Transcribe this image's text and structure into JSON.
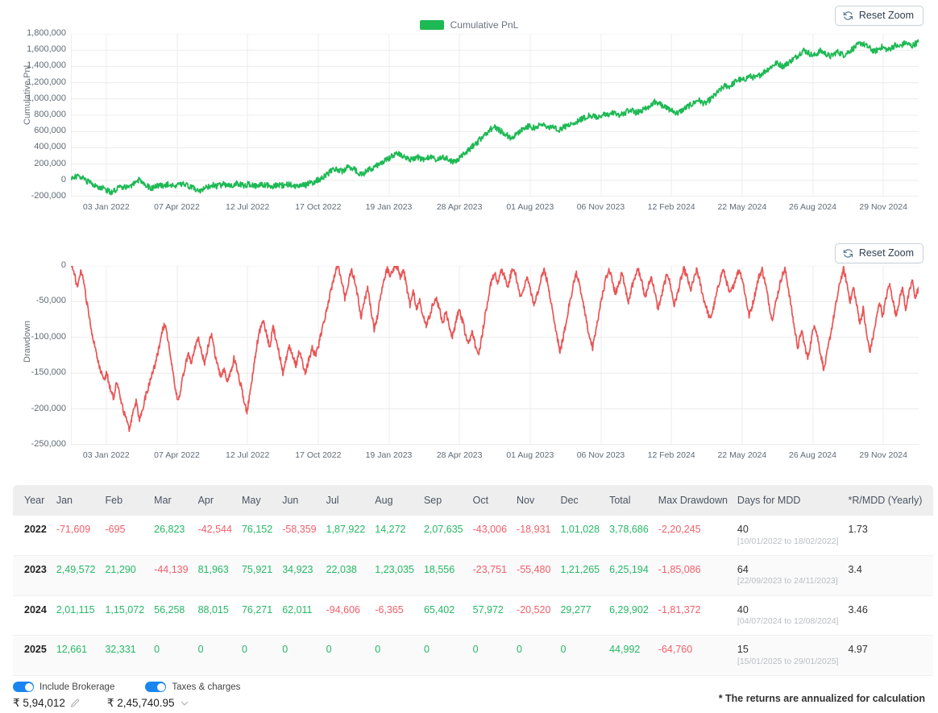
{
  "charts": {
    "pnl": {
      "reset_zoom_label": "Reset Zoom",
      "legend_label": "Cumulative PnL",
      "y_axis_title": "Cumulative PnL",
      "line_color": "#1db954"
    },
    "drawdown": {
      "reset_zoom_label": "Reset Zoom",
      "y_axis_title": "Drawdown",
      "line_color": "#ea5455"
    }
  },
  "chart_data": [
    {
      "type": "line",
      "name": "cumulative-pnl",
      "title": "",
      "xlabel": "",
      "ylabel": "Cumulative PnL",
      "legend": [
        "Cumulative PnL"
      ],
      "legend_position": "top-center",
      "grid": true,
      "ylim": [
        -200000,
        1800000
      ],
      "yticks": [
        1800000,
        1600000,
        1400000,
        1200000,
        1000000,
        800000,
        600000,
        400000,
        200000,
        0,
        -200000
      ],
      "ytick_labels": [
        "1,800,000",
        "1,600,000",
        "1,400,000",
        "1,200,000",
        "1,000,000",
        "800,000",
        "600,000",
        "400,000",
        "200,000",
        "0",
        "-200,000"
      ],
      "xtick_labels": [
        "03 Jan 2022",
        "07 Apr 2022",
        "12 Jul 2022",
        "17 Oct 2022",
        "19 Jan 2023",
        "28 Apr 2023",
        "01 Aug 2023",
        "06 Nov 2023",
        "12 Feb 2024",
        "22 May 2024",
        "26 Aug 2024",
        "29 Nov 2024"
      ],
      "series": [
        {
          "name": "Cumulative PnL",
          "color": "#1db954",
          "values": [
            0,
            30000,
            70000,
            40000,
            10000,
            -20000,
            -45000,
            -60000,
            -75000,
            -90000,
            -110000,
            -130000,
            -145000,
            -125000,
            -100000,
            -85000,
            -70000,
            -90000,
            -60000,
            -30000,
            5000,
            -20000,
            -55000,
            -80000,
            -95000,
            -75000,
            -60000,
            -70000,
            -55000,
            -45000,
            -60000,
            -75000,
            -58000,
            -48000,
            -62000,
            -80000,
            -95000,
            -115000,
            -135000,
            -110000,
            -85000,
            -70000,
            -60000,
            -75000,
            -62000,
            -48000,
            -58000,
            -70000,
            -55000,
            -42000,
            -55000,
            -68000,
            -52000,
            -45000,
            -60000,
            -72000,
            -58000,
            -50000,
            -65000,
            -78000,
            -66000,
            -54000,
            -68000,
            -58000,
            -48000,
            -60000,
            -72000,
            -60000,
            -50000,
            -62000,
            -45000,
            -30000,
            -15000,
            5000,
            25000,
            60000,
            90000,
            120000,
            145000,
            125000,
            105000,
            140000,
            165000,
            150000,
            120000,
            90000,
            75000,
            105000,
            130000,
            155000,
            175000,
            200000,
            225000,
            250000,
            280000,
            310000,
            340000,
            310000,
            285000,
            265000,
            250000,
            270000,
            290000,
            270000,
            255000,
            270000,
            290000,
            265000,
            250000,
            265000,
            280000,
            260000,
            240000,
            225000,
            250000,
            285000,
            320000,
            360000,
            400000,
            440000,
            475000,
            520000,
            560000,
            600000,
            635000,
            655000,
            630000,
            600000,
            570000,
            540000,
            515000,
            550000,
            590000,
            620000,
            650000,
            665000,
            640000,
            655000,
            670000,
            690000,
            665000,
            645000,
            660000,
            640000,
            625000,
            645000,
            665000,
            680000,
            700000,
            720000,
            745000,
            760000,
            780000,
            800000,
            785000,
            770000,
            790000,
            810000,
            795000,
            810000,
            830000,
            815000,
            800000,
            820000,
            845000,
            860000,
            845000,
            830000,
            855000,
            875000,
            895000,
            930000,
            965000,
            950000,
            930000,
            905000,
            880000,
            860000,
            840000,
            825000,
            855000,
            880000,
            910000,
            930000,
            960000,
            990000,
            960000,
            940000,
            975000,
            1010000,
            1050000,
            1090000,
            1130000,
            1165000,
            1150000,
            1180000,
            1215000,
            1240000,
            1225000,
            1250000,
            1280000,
            1270000,
            1255000,
            1290000,
            1320000,
            1350000,
            1380000,
            1410000,
            1440000,
            1425000,
            1400000,
            1430000,
            1460000,
            1490000,
            1520000,
            1560000,
            1600000,
            1580000,
            1555000,
            1530000,
            1560000,
            1590000,
            1570000,
            1545000,
            1520000,
            1550000,
            1580000,
            1560000,
            1540000,
            1570000,
            1600000,
            1630000,
            1660000,
            1690000,
            1665000,
            1640000,
            1610000,
            1580000,
            1610000,
            1640000,
            1620000,
            1600000,
            1630000,
            1660000,
            1640000,
            1660000,
            1690000,
            1670000,
            1650000,
            1680000,
            1700000
          ]
        }
      ]
    },
    {
      "type": "line",
      "name": "drawdown",
      "title": "",
      "xlabel": "",
      "ylabel": "Drawdown",
      "grid": true,
      "ylim": [
        -250000,
        0
      ],
      "yticks": [
        0,
        -50000,
        -100000,
        -150000,
        -200000,
        -250000
      ],
      "ytick_labels": [
        "0",
        "-50,000",
        "-100,000",
        "-150,000",
        "-200,000",
        "-250,000"
      ],
      "xtick_labels": [
        "03 Jan 2022",
        "07 Apr 2022",
        "12 Jul 2022",
        "17 Oct 2022",
        "19 Jan 2023",
        "28 Apr 2023",
        "01 Aug 2023",
        "06 Nov 2023",
        "12 Feb 2024",
        "22 May 2024",
        "26 Aug 2024",
        "29 Nov 2024"
      ],
      "series": [
        {
          "name": "Drawdown",
          "color": "#ea5455",
          "values": [
            0,
            -10000,
            -30000,
            -5000,
            -25000,
            -55000,
            -85000,
            -105000,
            -125000,
            -145000,
            -160000,
            -150000,
            -170000,
            -185000,
            -165000,
            -180000,
            -200000,
            -215000,
            -230000,
            -205000,
            -190000,
            -215000,
            -200000,
            -180000,
            -165000,
            -150000,
            -135000,
            -115000,
            -90000,
            -80000,
            -110000,
            -140000,
            -175000,
            -190000,
            -165000,
            -140000,
            -125000,
            -135000,
            -115000,
            -100000,
            -120000,
            -135000,
            -115000,
            -95000,
            -120000,
            -140000,
            -155000,
            -145000,
            -160000,
            -150000,
            -130000,
            -145000,
            -165000,
            -185000,
            -205000,
            -175000,
            -145000,
            -110000,
            -90000,
            -75000,
            -95000,
            -115000,
            -85000,
            -105000,
            -125000,
            -150000,
            -130000,
            -110000,
            -125000,
            -140000,
            -120000,
            -135000,
            -150000,
            -130000,
            -115000,
            -125000,
            -110000,
            -90000,
            -70000,
            -50000,
            -30000,
            -10000,
            0,
            -20000,
            -45000,
            -25000,
            -5000,
            -20000,
            -45000,
            -70000,
            -50000,
            -30000,
            -60000,
            -90000,
            -70000,
            -40000,
            -20000,
            -5000,
            -15000,
            -5000,
            0,
            -15000,
            -5000,
            -30000,
            -55000,
            -35000,
            -60000,
            -50000,
            -70000,
            -85000,
            -70000,
            -55000,
            -45000,
            -60000,
            -80000,
            -65000,
            -85000,
            -100000,
            -80000,
            -60000,
            -75000,
            -95000,
            -110000,
            -90000,
            -110000,
            -125000,
            -100000,
            -70000,
            -45000,
            -20000,
            -10000,
            -25000,
            -5000,
            -15000,
            -30000,
            -10000,
            -5000,
            -25000,
            -45000,
            -30000,
            -15000,
            -35000,
            -55000,
            -40000,
            -20000,
            -5000,
            -20000,
            -45000,
            -70000,
            -95000,
            -120000,
            -100000,
            -75000,
            -50000,
            -30000,
            -10000,
            -25000,
            -50000,
            -75000,
            -100000,
            -115000,
            -90000,
            -65000,
            -40000,
            -20000,
            -5000,
            -20000,
            -40000,
            -25000,
            -10000,
            -30000,
            -50000,
            -30000,
            -15000,
            -5000,
            -20000,
            -45000,
            -30000,
            -15000,
            -35000,
            -60000,
            -45000,
            -25000,
            -10000,
            -30000,
            -55000,
            -40000,
            -20000,
            -5000,
            -15000,
            -35000,
            -20000,
            -5000,
            -25000,
            -45000,
            -60000,
            -75000,
            -60000,
            -40000,
            -20000,
            -5000,
            -20000,
            -40000,
            -30000,
            -15000,
            -5000,
            -20000,
            -45000,
            -70000,
            -55000,
            -35000,
            -15000,
            -5000,
            -25000,
            -50000,
            -75000,
            -55000,
            -35000,
            -15000,
            -5000,
            -30000,
            -60000,
            -90000,
            -115000,
            -90000,
            -110000,
            -130000,
            -105000,
            -80000,
            -100000,
            -125000,
            -145000,
            -120000,
            -95000,
            -70000,
            -45000,
            -20000,
            -5000,
            -25000,
            -50000,
            -30000,
            -55000,
            -80000,
            -60000,
            -95000,
            -120000,
            -100000,
            -75000,
            -50000,
            -70000,
            -45000,
            -25000,
            -45000,
            -70000,
            -50000,
            -30000,
            -60000,
            -40000,
            -20000,
            -45000,
            -30000
          ]
        }
      ]
    }
  ],
  "table": {
    "headers": [
      "Year",
      "Jan",
      "Feb",
      "Mar",
      "Apr",
      "May",
      "Jun",
      "Jul",
      "Aug",
      "Sep",
      "Oct",
      "Nov",
      "Dec",
      "Total",
      "Max Drawdown",
      "Days for MDD",
      "*R/MDD (Yearly)"
    ],
    "rows": [
      {
        "year": "2022",
        "months": [
          "-71,609",
          "-695",
          "26,823",
          "-42,544",
          "76,152",
          "-58,359",
          "1,87,922",
          "14,272",
          "2,07,635",
          "-43,006",
          "-18,931",
          "1,01,028"
        ],
        "total": "3,78,686",
        "max_drawdown": "-2,20,245",
        "mdd_days": "40",
        "mdd_range": "[10/01/2022 to 18/02/2022]",
        "r_mdd": "1.73"
      },
      {
        "year": "2023",
        "months": [
          "2,49,572",
          "21,290",
          "-44,139",
          "81,963",
          "75,921",
          "34,923",
          "22,038",
          "1,23,035",
          "18,556",
          "-23,751",
          "-55,480",
          "1,21,265"
        ],
        "total": "6,25,194",
        "max_drawdown": "-1,85,086",
        "mdd_days": "64",
        "mdd_range": "[22/09/2023 to 24/11/2023]",
        "r_mdd": "3.4"
      },
      {
        "year": "2024",
        "months": [
          "2,01,115",
          "1,15,072",
          "56,258",
          "88,015",
          "76,271",
          "62,011",
          "-94,606",
          "-6,365",
          "65,402",
          "57,972",
          "-20,520",
          "29,277"
        ],
        "total": "6,29,902",
        "max_drawdown": "-1,81,372",
        "mdd_days": "40",
        "mdd_range": "[04/07/2024 to 12/08/2024]",
        "r_mdd": "3.46"
      },
      {
        "year": "2025",
        "months": [
          "12,661",
          "32,331",
          "0",
          "0",
          "0",
          "0",
          "0",
          "0",
          "0",
          "0",
          "0",
          "0"
        ],
        "total": "44,992",
        "max_drawdown": "-64,760",
        "mdd_days": "15",
        "mdd_range": "[15/01/2025 to 29/01/2025]",
        "r_mdd": "4.97"
      }
    ]
  },
  "footer": {
    "brokerage_toggle_label": "Include Brokerage",
    "brokerage_value": "₹ 5,94,012",
    "taxes_toggle_label": "Taxes & charges",
    "taxes_value": "₹ 2,45,740.95",
    "footnote": "* The returns are annualized for calculation",
    "toggle_on_color": "#1a85f0"
  }
}
